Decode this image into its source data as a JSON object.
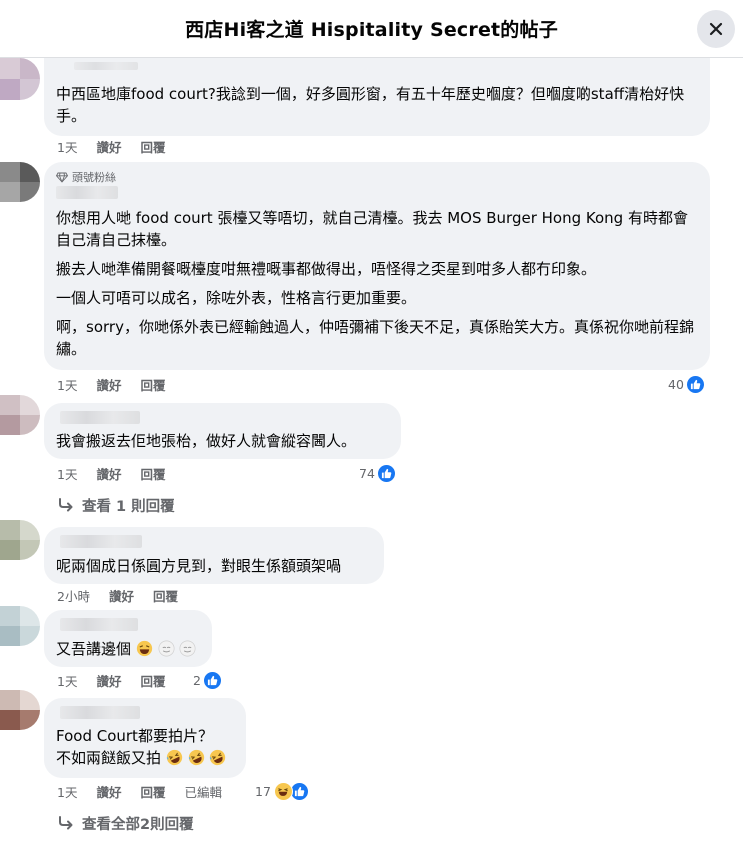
{
  "header": {
    "title": "西店Hi客之道 Hispitality Secret的帖子"
  },
  "colors": {
    "accent": "#1877f2",
    "meta_text": "#65676b",
    "bubble_bg": "#f0f2f5"
  },
  "comments": [
    {
      "text": "中西區地庫food court?我諗到一個，好多圓形窗，有五十年歷史嗰度？但嗰度啲staff清枱好快手。",
      "time": "1天",
      "like": "讚好",
      "reply": "回覆"
    },
    {
      "badge": "頭號粉絲",
      "paragraphs": [
        "你想用人哋 food court 張檯又等唔切，就自己清檯。我去 MOS Burger Hong Kong 有時都會自己清自己抹檯。",
        "搬去人哋準備開餐嘅檯度咁無禮嘅事都做得出，唔怪得之奀星到咁多人都冇印象。",
        "一個人可唔可以成名，除咗外表，性格言行更加重要。",
        "啊，sorry，你哋係外表已經輸蝕過人，仲唔彌補下後天不足，真係貽笑大方。真係祝你哋前程錦繡。"
      ],
      "time": "1天",
      "like": "讚好",
      "reply": "回覆",
      "reaction_count": "40"
    },
    {
      "text": "我會搬返去佢地張枱，做好人就會縱容閪人。",
      "time": "1天",
      "like": "讚好",
      "reply": "回覆",
      "reaction_count": "74",
      "view_replies": "查看 1 則回覆"
    },
    {
      "text": "呢兩個成日係圓方見到，對眼生係額頭架喎",
      "time": "2小時",
      "like": "讚好",
      "reply": "回覆"
    },
    {
      "text": "又吾講邊個",
      "time": "1天",
      "like": "讚好",
      "reply": "回覆",
      "reaction_count": "2"
    },
    {
      "line1": "Food Court都要拍片？",
      "line2": "不如兩餸飯又拍",
      "time": "1天",
      "like": "讚好",
      "reply": "回覆",
      "edited": "已編輯",
      "reaction_count": "17",
      "view_replies": "查看全部2則回覆"
    }
  ]
}
